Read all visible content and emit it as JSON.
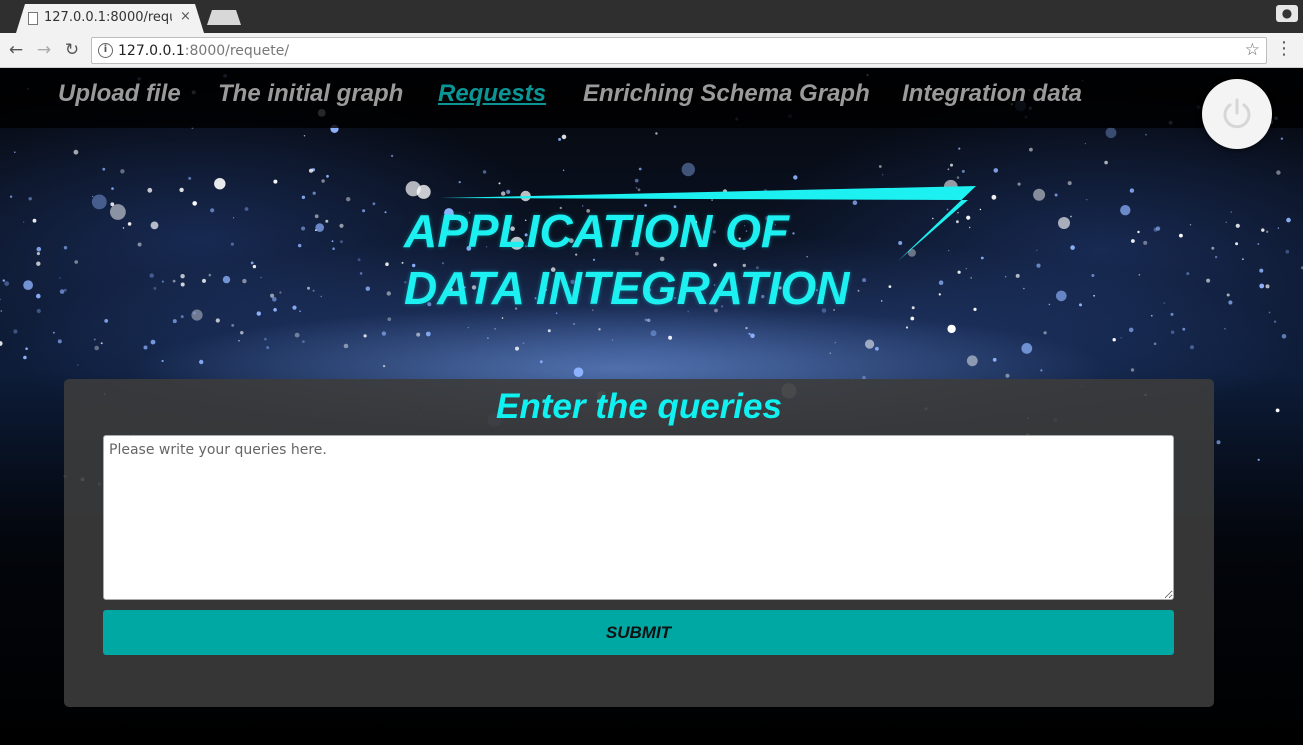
{
  "browser": {
    "tab_title": "127.0.0.1:8000/reque",
    "tab_close": "×",
    "url_host": "127.0.0.1",
    "url_rest": ":8000/requete/",
    "back_icon": "←",
    "forward_icon": "→",
    "reload_icon": "↻",
    "info_icon": "i",
    "star_icon": "☆",
    "menu_icon": "⋮",
    "profile_icon": "●"
  },
  "navbar": {
    "items": [
      {
        "label": "Upload file",
        "active": false
      },
      {
        "label": "The initial graph",
        "active": false
      },
      {
        "label": "Requests",
        "active": true
      },
      {
        "label": "Enriching Schema Graph",
        "active": false
      },
      {
        "label": "Integration data",
        "active": false
      }
    ],
    "power_icon": "power-icon"
  },
  "hero": {
    "line1": "APPLICATION OF",
    "line2": "DATA INTEGRATION"
  },
  "form": {
    "title": "Enter the queries",
    "query_placeholder": "Please write your queries here.",
    "query_value": "",
    "submit_label": "SUBMIT"
  },
  "colors": {
    "accent": "#1df0f0",
    "nav_active": "#0c9595",
    "submit_bg": "#00a8a3",
    "panel_bg": "#3c3c3c"
  }
}
